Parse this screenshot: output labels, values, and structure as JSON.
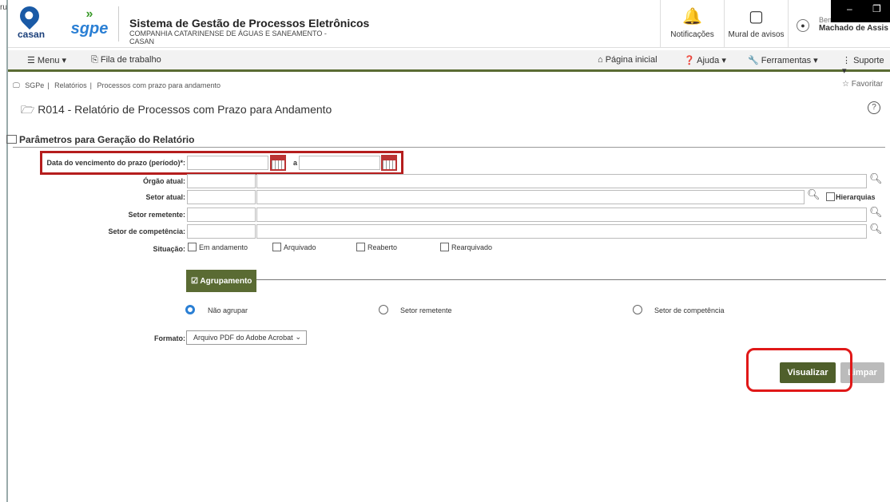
{
  "edge_text": "ru",
  "logo": {
    "casan": "casan",
    "sgpe": "sgpe"
  },
  "system": {
    "title": "Sistema de Gestão de Processos Eletrônicos",
    "subtitle": "COMPANHIA CATARINENSE DE ÁGUAS E SANEAMENTO - CASAN"
  },
  "header": {
    "notifications": "Notificações",
    "mural": "Mural de avisos",
    "user_prefix": "Ben",
    "user_name": "Machado de Assis"
  },
  "window": {
    "minimize": "–",
    "restore": "❐"
  },
  "menubar": {
    "menu": "Menu",
    "fila": "Fila de trabalho",
    "home": "Página inicial",
    "ajuda": "Ajuda",
    "ferramentas": "Ferramentas",
    "suporte": "Suporte"
  },
  "breadcrumb": [
    "SGPe",
    "Relatórios",
    "Processos com prazo para andamento"
  ],
  "favorite": "Favoritar",
  "page_title": "R014 - Relatório de Processos com Prazo para Andamento",
  "section_title": "Parâmetros para Geração do Relatório",
  "form": {
    "date_label": "Data do vencimento do prazo (período)*:",
    "date_sep": "a",
    "orgao_label": "Órgão atual:",
    "setor_atual_label": "Setor atual:",
    "hierarquias": "Hierarquias",
    "setor_remetente_label": "Setor remetente:",
    "setor_competencia_label": "Setor de competência:",
    "situacao_label": "Situação:",
    "situacao_options": [
      "Em andamento",
      "Arquivado",
      "Reaberto",
      "Rearquivado"
    ],
    "agrupamento": "Agrupamento",
    "radio_options": [
      "Não agrupar",
      "Setor remetente",
      "Setor de competência"
    ],
    "formato_label": "Formato:",
    "formato_value": "Arquivo PDF do Adobe Acrobat"
  },
  "buttons": {
    "visualizar": "Visualizar",
    "limpar": "Limpar"
  }
}
